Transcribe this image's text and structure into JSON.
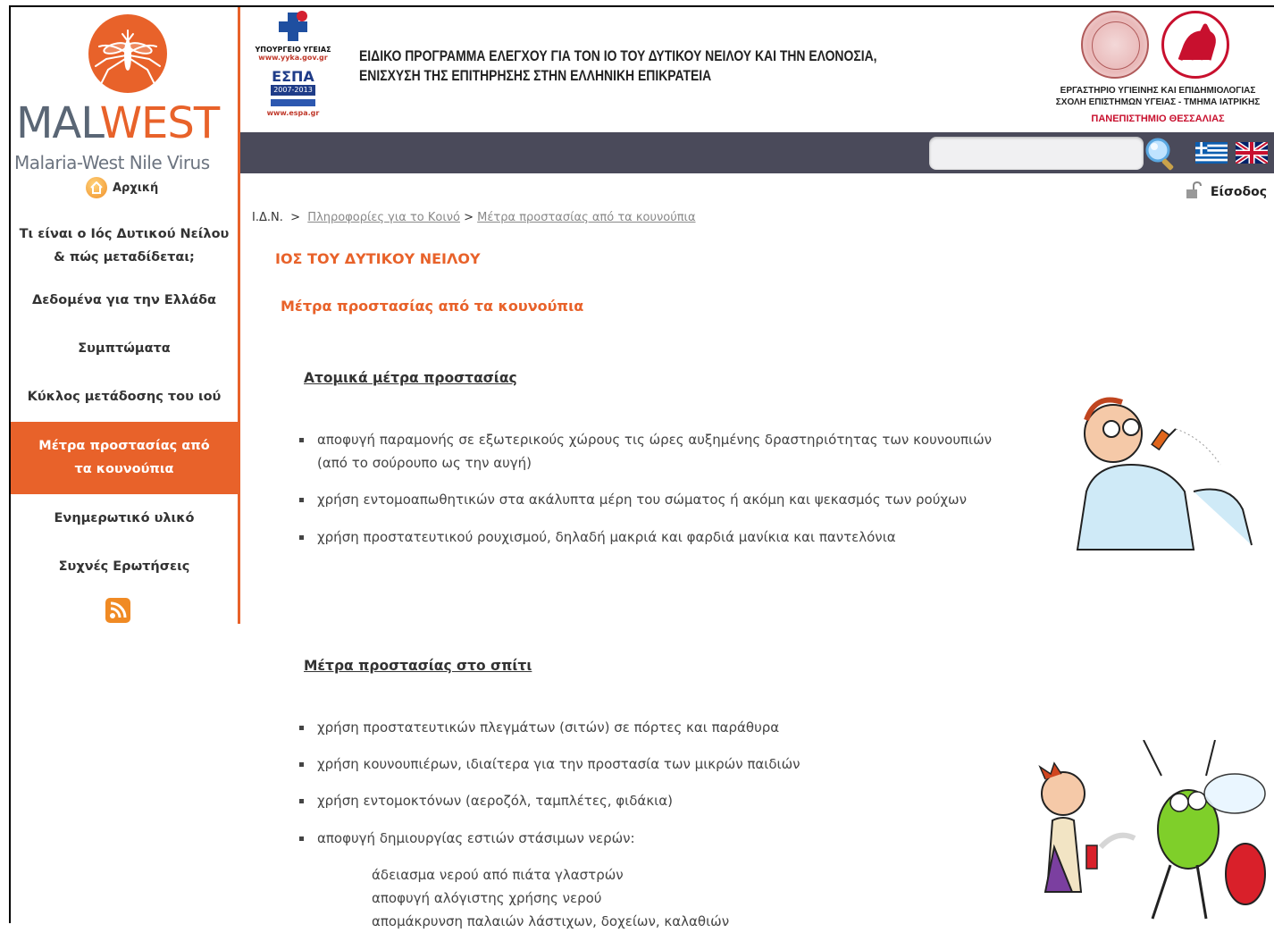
{
  "logo": {
    "mal": "MAL",
    "west": "WEST",
    "subtitle": "Malaria-West Nile Virus"
  },
  "header": {
    "title_line1": "ΕΙΔΙΚΟ ΠΡΟΓΡΑΜΜΑ ΕΛΕΓΧΟΥ ΓΙΑ ΤΟΝ ΙΟ ΤΟΥ ΔΥΤΙΚΟΥ ΝΕΙΛΟΥ ΚΑΙ ΤΗΝ ΕΛΟΝΟΣΙΑ,",
    "title_line2": "ΕΝΙΣΧΥΣΗ ΤΗΣ ΕΠΙΤΗΡΗΣΗΣ ΣΤΗΝ ΕΛΛΗΝΙΚΗ ΕΠΙΚΡΑΤΕΙΑ",
    "gov_ministry": "ΥΠΟΥΡΓΕΙΟ ΥΓΕΙΑΣ",
    "gov_url": "www.yyka.gov.gr",
    "espa": "ΕΣΠΑ",
    "espa_years": "2007-2013",
    "espa_url": "www.espa.gr",
    "univ_line1": "ΕΡΓΑΣΤΗΡΙΟ ΥΓΙΕΙΝΗΣ ΚΑΙ ΕΠΙΔΗΜΙΟΛΟΓΙΑΣ",
    "univ_line2": "ΣΧΟΛΗ ΕΠΙΣΤΗΜΩΝ ΥΓΕΙΑΣ - ΤΜΗΜΑ ΙΑΤΡΙΚΗΣ",
    "univ_line3": "ΠΑΝΕΠΙΣΤΗΜΙΟ ΘΕΣΣΑΛΙΑΣ"
  },
  "search": {
    "placeholder": "",
    "icon": "search-icon"
  },
  "login": {
    "label": "Είσοδος",
    "icon": "lock-icon"
  },
  "sidebar": {
    "home_label": "Αρχική",
    "items": [
      {
        "label": "Τι είναι ο Ιός Δυτικού Νείλου & πώς μεταδίδεται;"
      },
      {
        "label": "Δεδομένα για την Ελλάδα"
      },
      {
        "label": "Συμπτώματα"
      },
      {
        "label": "Κύκλος μετάδοσης του ιού"
      },
      {
        "label": "Μέτρα προστασίας από τα κουνούπια"
      },
      {
        "label": "Ενημερωτικό υλικό"
      },
      {
        "label": "Συχνές Ερωτήσεις"
      }
    ]
  },
  "breadcrumb": {
    "root": "Ι.Δ.Ν.",
    "sep": ">",
    "link1": "Πληροφορίες για το Κοινό",
    "link2": "Μέτρα προστασίας από τα κουνούπια"
  },
  "content": {
    "section_title": "ΙΟΣ ΤΟΥ ΔΥΤΙΚΟΥ ΝΕΙΛΟΥ",
    "page_title": "Μέτρα προστασίας από τα κουνούπια",
    "personal_heading": "Ατομικά μέτρα προστασίας",
    "personal_items": [
      "αποφυγή παραμονής σε εξωτερικούς χώρους τις ώρες αυξημένης δραστηριότητας των κουνουπιών (από το σούρουπο ως την αυγή)",
      "χρήση εντομοαπωθητικών στα ακάλυπτα μέρη του σώματος ή ακόμη και ψεκασμός των ρούχων",
      "χρήση προστατευτικού ρουχισμού, δηλαδή μακριά και φαρδιά μανίκια και παντελόνια"
    ],
    "home_heading": "Μέτρα προστασίας στο σπίτι",
    "home_items": [
      "χρήση προστατευτικών πλεγμάτων (σιτών) σε πόρτες και παράθυρα",
      "χρήση κουνουπιέρων, ιδιαίτερα για την προστασία των μικρών παιδιών",
      "χρήση εντομοκτόνων (αεροζόλ, ταμπλέτες, φιδάκια)",
      "αποφυγή δημιουργίας εστιών στάσιμων νερών:"
    ],
    "sub_items": [
      "άδειασμα νερού από πιάτα γλαστρών",
      "αποφυγή αλόγιστης χρήσης νερού",
      "απομάκρυνση παλαιών λάστιχων, δοχείων, καλαθιών"
    ]
  },
  "colors": {
    "accent": "#e8622a",
    "bar": "#4a4a5a"
  }
}
